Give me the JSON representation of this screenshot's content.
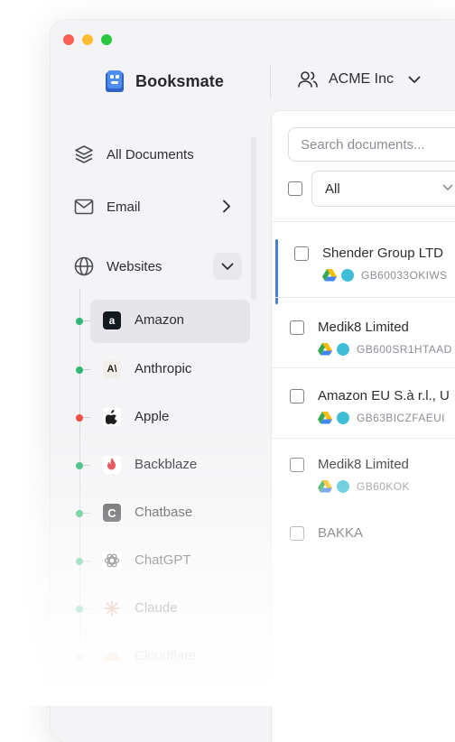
{
  "app": {
    "name": "Booksmate"
  },
  "org": {
    "name": "ACME Inc"
  },
  "sidebar": {
    "all_documents": "All Documents",
    "email": "Email",
    "websites": "Websites",
    "sites": [
      {
        "name": "Amazon",
        "status_color": "#2eb872",
        "selected": true
      },
      {
        "name": "Anthropic",
        "status_color": "#2eb872"
      },
      {
        "name": "Apple",
        "status_color": "#f04e45"
      },
      {
        "name": "Backblaze",
        "status_color": "#2eb872"
      },
      {
        "name": "Chatbase",
        "status_color": "#2eb872"
      },
      {
        "name": "ChatGPT",
        "status_color": "#2eb872"
      },
      {
        "name": "Claude",
        "status_color": "#2eb872"
      },
      {
        "name": "Cloudflare",
        "status_color": "#f6a451"
      }
    ]
  },
  "main": {
    "search_placeholder": "Search documents...",
    "filter_value": "All",
    "documents": [
      {
        "title": "Shender Group LTD",
        "vat": "GB60033OKIWS"
      },
      {
        "title": "Medik8 Limited",
        "vat": "GB600SR1HTAAD"
      },
      {
        "title": "Amazon EU S.à r.l., U",
        "vat": "GB63BICZFAEUI"
      },
      {
        "title": "Medik8 Limited",
        "vat": "GB60KOK"
      },
      {
        "title": "BAKKA",
        "vat": ""
      }
    ]
  },
  "colors": {
    "accent": "#4a7fd4",
    "ok": "#2eb872",
    "error": "#f04e45",
    "warning": "#f6a451"
  }
}
